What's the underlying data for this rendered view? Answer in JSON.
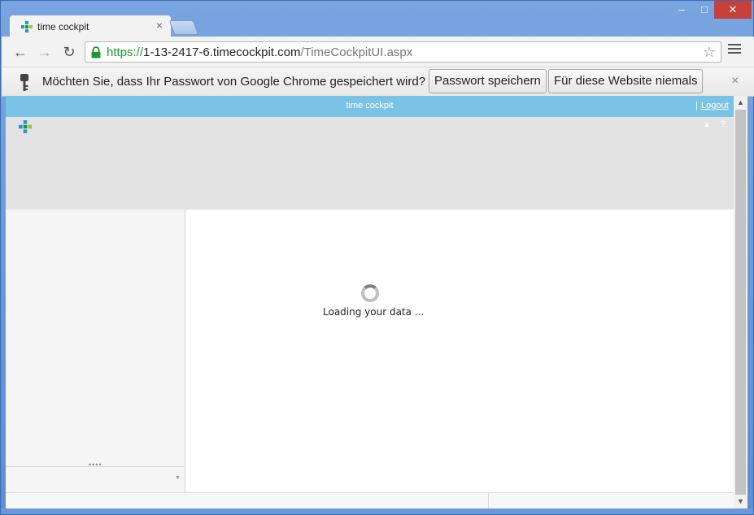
{
  "browser": {
    "tab_title": "time cockpit",
    "tab_close": "×",
    "url_scheme": "https://",
    "url_host": "1-13-2417-6.timecockpit.com",
    "url_path": "/TimeCockpitUI.aspx",
    "window_controls": {
      "minimize": "–",
      "maximize": "□",
      "close": "✕"
    },
    "nav": {
      "back": "←",
      "forward": "→",
      "reload": "↻"
    },
    "star": "☆"
  },
  "infobar": {
    "message": "Möchten Sie, dass Ihr Passwort von Google Chrome gespeichert wird?",
    "save_button": "Passwort speichern",
    "never_button": "Für diese Website niemals",
    "close": "×"
  },
  "app": {
    "title": "time cockpit",
    "separator": "|",
    "logout": "Logout",
    "collapse": "▲",
    "help": "?",
    "loading_text": "Loading your data ...",
    "grip": "••••",
    "dropdown": "▼"
  },
  "scrollbar": {
    "up": "▲",
    "down": "▼"
  },
  "colors": {
    "appbar": "#7ac3e6",
    "ribbon": "#e3e3e3",
    "secure_green": "#1a9a2b",
    "window_frame": "#6b98d6"
  },
  "icons": [
    "time-cockpit-logo-icon",
    "lock-icon",
    "star-icon",
    "menu-icon",
    "key-icon",
    "spinner-icon"
  ]
}
